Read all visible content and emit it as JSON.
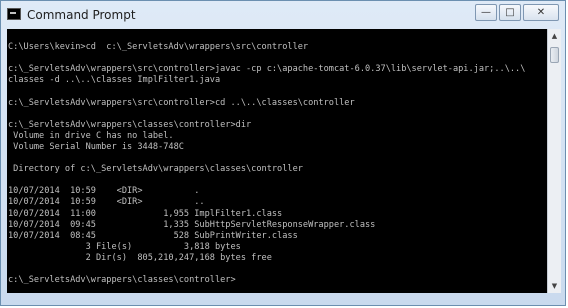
{
  "window": {
    "title": "Command Prompt",
    "controls": {
      "minimize": "—",
      "maximize": "□",
      "close": "✕"
    }
  },
  "console": {
    "lines": [
      "",
      "C:\\Users\\kevin>cd  c:\\_ServletsAdv\\wrappers\\src\\controller",
      "",
      "c:\\_ServletsAdv\\wrappers\\src\\controller>javac -cp c:\\apache-tomcat-6.0.37\\lib\\servlet-api.jar;..\\..\\",
      "classes -d ..\\..\\classes ImplFilter1.java",
      "",
      "c:\\_ServletsAdv\\wrappers\\src\\controller>cd ..\\..\\classes\\controller",
      "",
      "c:\\_ServletsAdv\\wrappers\\classes\\controller>dir",
      " Volume in drive C has no label.",
      " Volume Serial Number is 3448-748C",
      "",
      " Directory of c:\\_ServletsAdv\\wrappers\\classes\\controller",
      "",
      "10/07/2014  10:59    <DIR>          .",
      "10/07/2014  10:59    <DIR>          ..",
      "10/07/2014  11:00             1,955 ImplFilter1.class",
      "10/07/2014  09:45             1,335 SubHttpServletResponseWrapper.class",
      "10/07/2014  08:45               528 SubPrintWriter.class",
      "               3 File(s)          3,818 bytes",
      "               2 Dir(s)  805,210,247,168 bytes free",
      "",
      "c:\\_ServletsAdv\\wrappers\\classes\\controller>"
    ]
  },
  "scrollbar": {
    "up_arrow": "▲",
    "down_arrow": "▼"
  }
}
